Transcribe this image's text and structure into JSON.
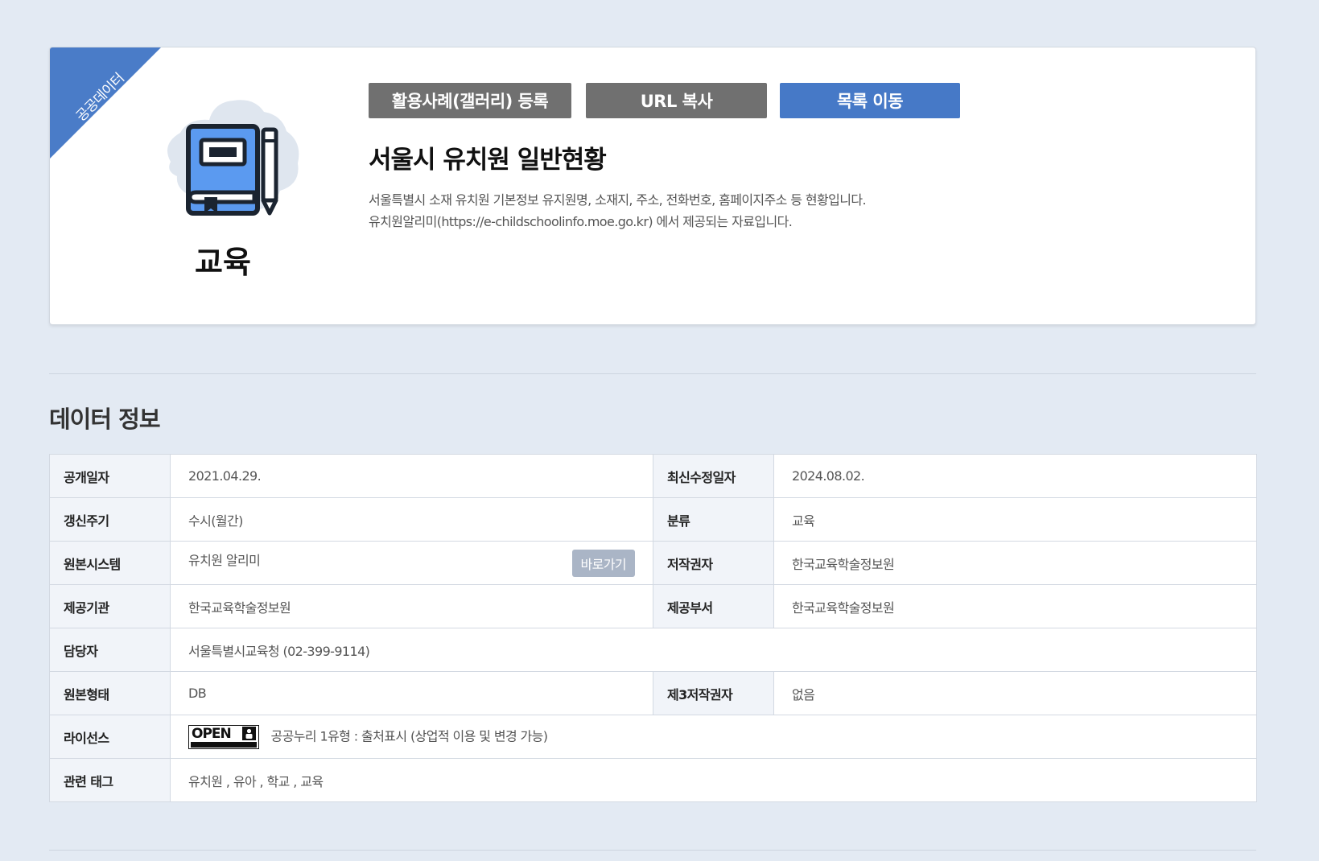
{
  "header": {
    "ribbon": "공공데이터",
    "category": "교육",
    "icon": "book-pencil-icon",
    "buttons": {
      "gallery": "활용사례(갤러리) 등록",
      "copy_url": "URL 복사",
      "list": "목록 이동"
    },
    "title": "서울시 유치원 일반현황",
    "description": [
      "서울특별시 소재 유치원 기본정보 유지원명, 소재지, 주소, 전화번호, 홈페이지주소 등 현황입니다.",
      "유치원알리미(https://e-childschoolinfo.moe.go.kr) 에서 제공되는 자료입니다."
    ]
  },
  "section": {
    "title": "데이터 정보",
    "rows": {
      "publish_date": {
        "label": "공개일자",
        "value": "2021.04.29."
      },
      "last_modified": {
        "label": "최신수정일자",
        "value": "2024.08.02."
      },
      "update_cycle": {
        "label": "갱신주기",
        "value": "수시(월간)"
      },
      "classification": {
        "label": "분류",
        "value": "교육"
      },
      "source_system": {
        "label": "원본시스템",
        "value": "유치원 알리미",
        "button": "바로가기"
      },
      "copyright_holder": {
        "label": "저작권자",
        "value": "한국교육학술정보원"
      },
      "provider_org": {
        "label": "제공기관",
        "value": "한국교육학술정보원"
      },
      "provider_dept": {
        "label": "제공부서",
        "value": "한국교육학술정보원"
      },
      "contact": {
        "label": "담당자",
        "value": "서울특별시교육청 (02-399-9114)"
      },
      "source_format": {
        "label": "원본형태",
        "value": "DB"
      },
      "third_party": {
        "label": "제3저작권자",
        "value": "없음"
      },
      "license": {
        "label": "라이선스",
        "badge": "OPEN",
        "value": "공공누리 1유형 : 출처표시 (상업적 이용 및 변경 가능)"
      },
      "tags": {
        "label": "관련 태그",
        "value": "유치원 , 유아 , 학교 , 교육"
      }
    }
  },
  "colors": {
    "background": "#e3eaf3",
    "accent": "#4a7cc8",
    "button_gray": "#707070",
    "button_blue": "#4679c7",
    "icon_blue": "#5b9af0"
  }
}
